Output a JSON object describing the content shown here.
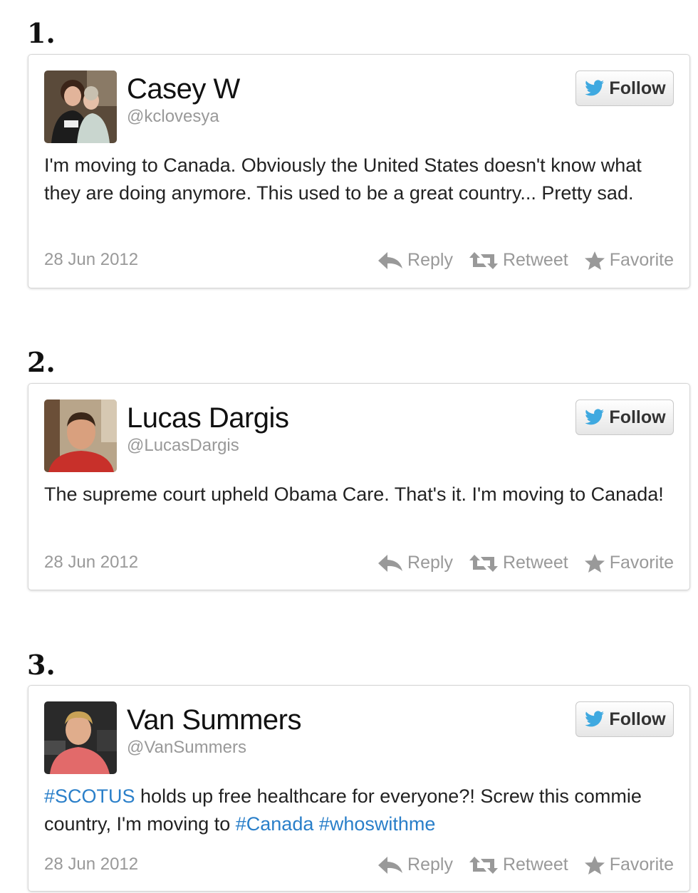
{
  "tweets": [
    {
      "number": "1.",
      "name": "Casey W",
      "handle": "@kclovesya",
      "follow_label": "Follow",
      "text_segments": [
        {
          "text": "I'm moving to Canada. Obviously the United States doesn't know what they are doing anymore. This used to be a great country... Pretty sad.",
          "hashtag": false
        }
      ],
      "date": "28 Jun 2012",
      "actions": {
        "reply": "Reply",
        "retweet": "Retweet",
        "favorite": "Favorite"
      }
    },
    {
      "number": "2.",
      "name": "Lucas Dargis",
      "handle": "@LucasDargis",
      "follow_label": "Follow",
      "text_segments": [
        {
          "text": "The supreme court upheld Obama Care. That's it. I'm moving to Canada!",
          "hashtag": false
        }
      ],
      "date": "28 Jun 2012",
      "actions": {
        "reply": "Reply",
        "retweet": "Retweet",
        "favorite": "Favorite"
      }
    },
    {
      "number": "3.",
      "name": "Van Summers",
      "handle": "@VanSummers",
      "follow_label": "Follow",
      "text_segments": [
        {
          "text": "#SCOTUS",
          "hashtag": true
        },
        {
          "text": " holds up free healthcare for everyone?! Screw this commie country, I'm moving to ",
          "hashtag": false
        },
        {
          "text": "#Canada",
          "hashtag": true
        },
        {
          "text": " ",
          "hashtag": false
        },
        {
          "text": "#whoswithme",
          "hashtag": true
        }
      ],
      "date": "28 Jun 2012",
      "actions": {
        "reply": "Reply",
        "retweet": "Retweet",
        "favorite": "Favorite"
      }
    }
  ],
  "icons": {
    "follow": "twitter-bird-icon",
    "reply": "reply-arrow-icon",
    "retweet": "retweet-icon",
    "favorite": "star-icon"
  },
  "colors": {
    "hashtag": "#2a7fc9",
    "twitter_bird": "#3fa9e0",
    "meta_text": "#999999",
    "card_border": "#d6d6d6"
  }
}
